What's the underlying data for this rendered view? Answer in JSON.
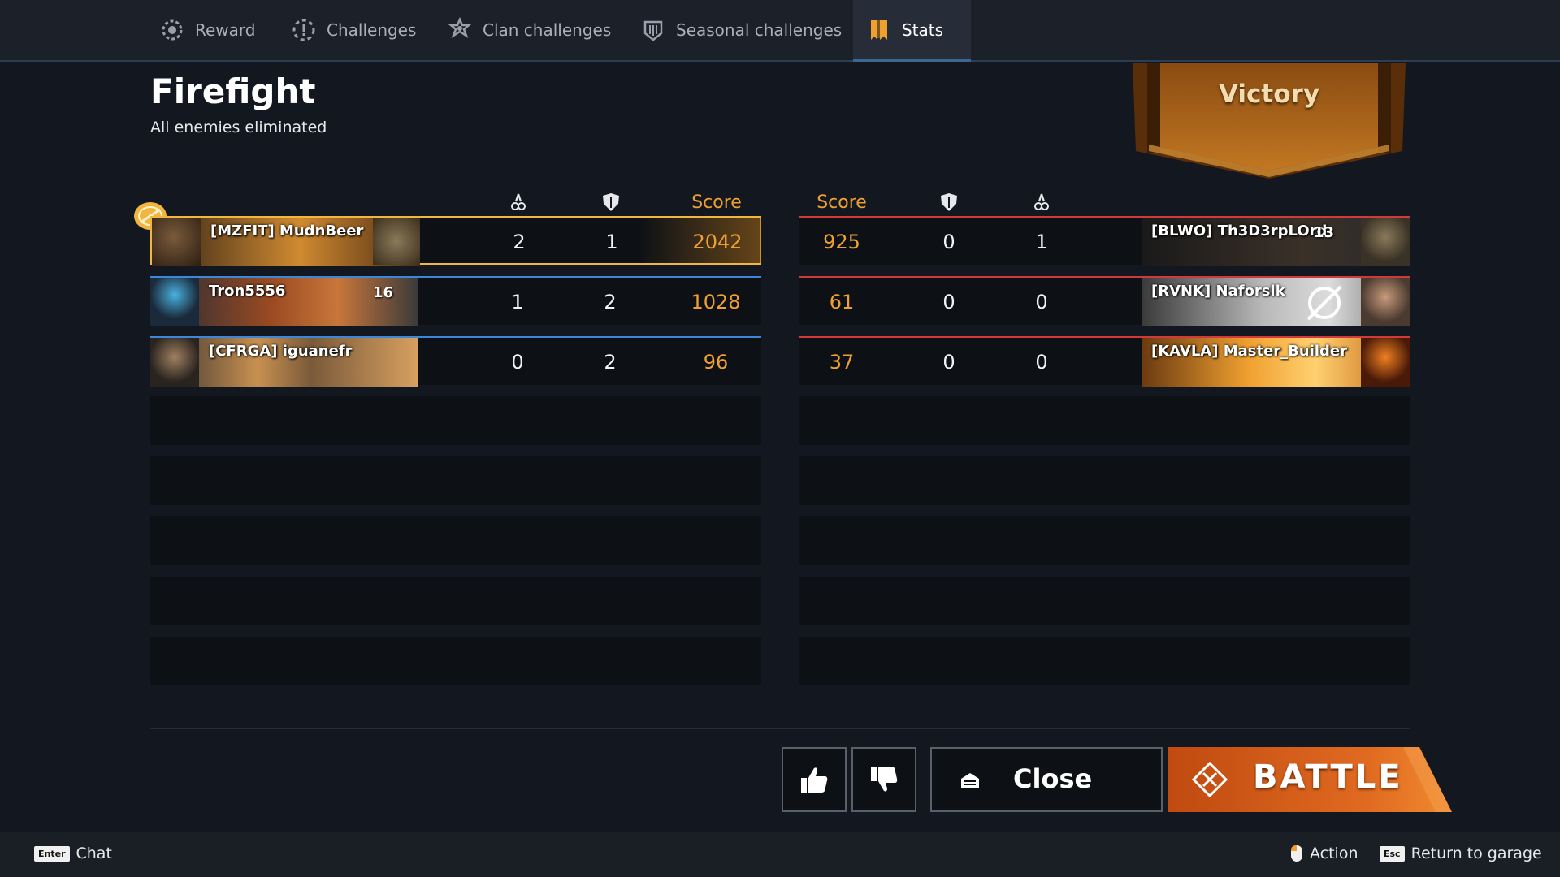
{
  "tabs": [
    {
      "label": "Reward",
      "icon": "gear-medal-icon"
    },
    {
      "label": "Challenges",
      "icon": "challenge-icon"
    },
    {
      "label": "Clan challenges",
      "icon": "clan-challenge-icon"
    },
    {
      "label": "Seasonal challenges",
      "icon": "seasonal-challenge-icon"
    },
    {
      "label": "Stats",
      "icon": "stats-bookmark-icon",
      "active": true
    }
  ],
  "mode": {
    "title": "Firefight",
    "subtitle": "All enemies eliminated"
  },
  "result": {
    "label": "Victory"
  },
  "headers": {
    "score": "Score",
    "kills_icon": "kills-icon",
    "assists_icon": "shield-icon"
  },
  "ally_team": [
    {
      "name": "[MZFIT] MudnBeer",
      "level": "",
      "kills": "2",
      "assists": "1",
      "score": "2042",
      "mvp": true
    },
    {
      "name": "Tron5556",
      "level": "16",
      "kills": "1",
      "assists": "2",
      "score": "1028"
    },
    {
      "name": "[CFRGA] iguanefr",
      "level": "",
      "kills": "0",
      "assists": "2",
      "score": "96"
    }
  ],
  "enemy_team": [
    {
      "name": "[BLWO] Th3D3rpLOrd",
      "level": "13",
      "score": "925",
      "assists": "0",
      "kills": "1"
    },
    {
      "name": "[RVNK] Naforsik",
      "level": "",
      "score": "61",
      "assists": "0",
      "kills": "0"
    },
    {
      "name": "[KAVLA] Master_Builder",
      "level": "",
      "score": "37",
      "assists": "0",
      "kills": "0"
    }
  ],
  "buttons": {
    "like_icon": "thumbs-up-icon",
    "dislike_icon": "thumbs-down-icon",
    "close": "Close",
    "battle": "BATTLE"
  },
  "hints": [
    {
      "key": "Enter",
      "label": "Chat"
    },
    {
      "key": "mouse-left-icon",
      "label": "Action"
    },
    {
      "key": "Esc",
      "label": "Return to garage"
    }
  ],
  "colors": {
    "accent_orange": "#f0a030",
    "ally_blue": "#3d86d8",
    "enemy_red": "#d23a3a",
    "highlight_gold": "#f0b640"
  }
}
